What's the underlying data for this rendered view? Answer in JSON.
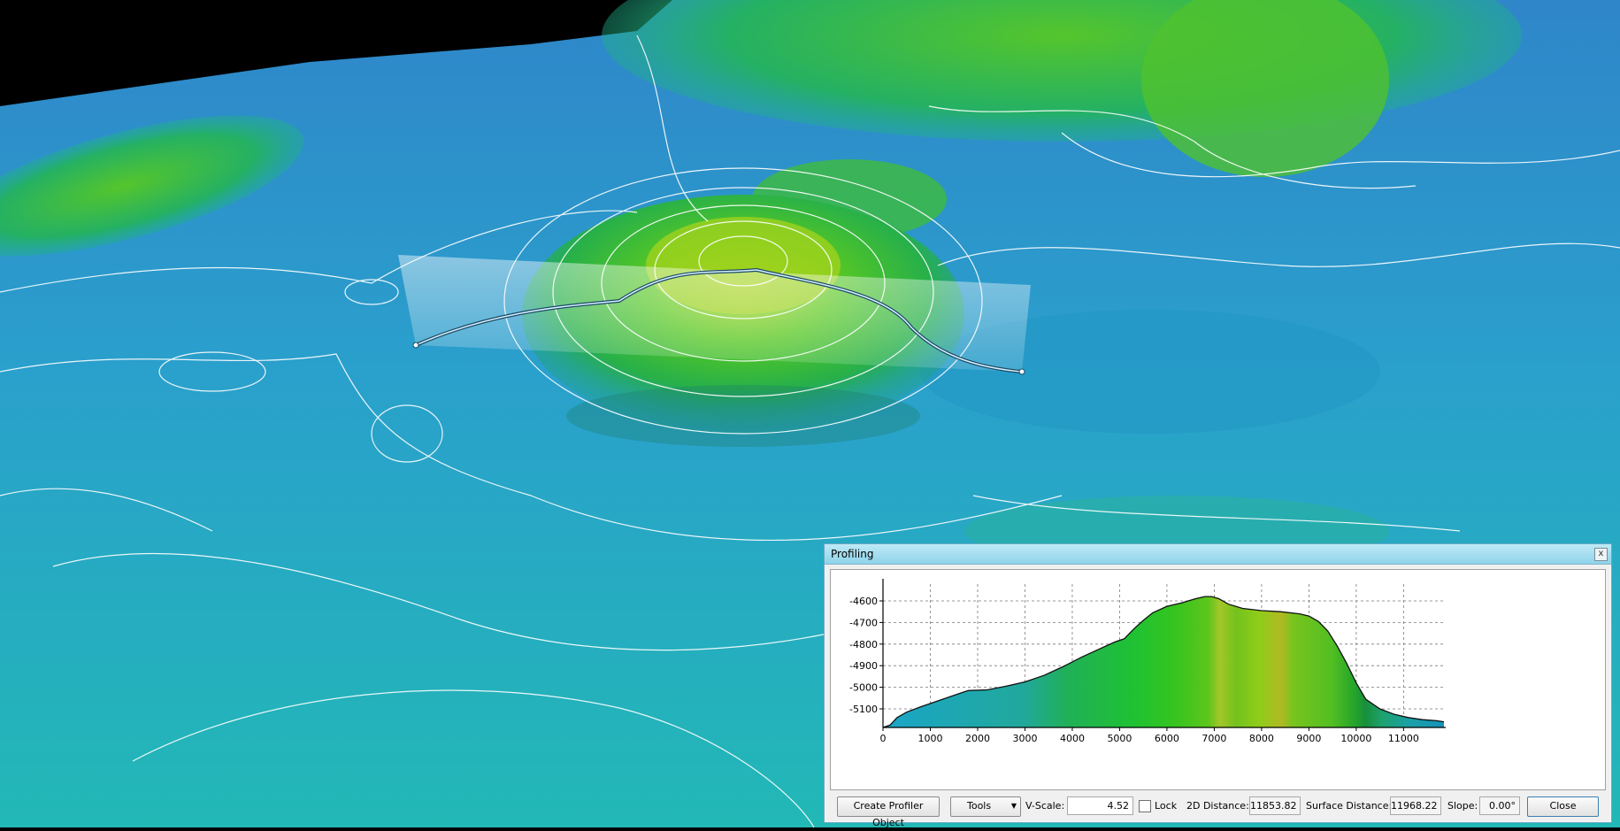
{
  "panel": {
    "title": "Profiling",
    "close_glyph": "x"
  },
  "toolbar": {
    "create_label": "Create Profiler Object",
    "tools_label": "Tools",
    "vscale_label": "V-Scale:",
    "vscale_value": "4.52",
    "lock_label": "Lock",
    "lock_checked": false,
    "dist2d_label": "2D Distance:",
    "dist2d_value": "11853.82",
    "surface_label": "Surface Distance:",
    "surface_value": "11968.22",
    "slope_label": "Slope:",
    "slope_value": "0.00°",
    "close_label": "Close"
  },
  "chart_data": {
    "type": "area",
    "title": "",
    "xlabel": "",
    "ylabel": "",
    "xlim": [
      0,
      11853
    ],
    "ylim": [
      -5200,
      -4530
    ],
    "x_ticks": [
      0,
      1000,
      2000,
      3000,
      4000,
      5000,
      6000,
      7000,
      8000,
      9000,
      10000,
      11000
    ],
    "y_ticks": [
      -4600,
      -4700,
      -4800,
      -4900,
      -5000,
      -5100
    ],
    "grid": true,
    "series": [
      {
        "x": [
          0,
          150,
          300,
          500,
          800,
          1200,
          1600,
          1800,
          2200,
          2600,
          3000,
          3400,
          3800,
          4200,
          4600,
          4900,
          5100,
          5300,
          5500,
          5700,
          6000,
          6300,
          6600,
          6800,
          6950,
          7100,
          7300,
          7600,
          8000,
          8400,
          8800,
          9000,
          9200,
          9400,
          9600,
          9800,
          10000,
          10200,
          10500,
          10800,
          11100,
          11400,
          11700,
          11853
        ],
        "y": [
          -5205,
          -5175,
          -5140,
          -5115,
          -5090,
          -5060,
          -5030,
          -5015,
          -5012,
          -4995,
          -4975,
          -4945,
          -4905,
          -4860,
          -4820,
          -4790,
          -4775,
          -4730,
          -4690,
          -4655,
          -4625,
          -4610,
          -4590,
          -4580,
          -4580,
          -4590,
          -4615,
          -4635,
          -4645,
          -4650,
          -4660,
          -4670,
          -4695,
          -4740,
          -4810,
          -4890,
          -4980,
          -5055,
          -5100,
          -5125,
          -5140,
          -5150,
          -5155,
          -5160
        ]
      }
    ]
  }
}
